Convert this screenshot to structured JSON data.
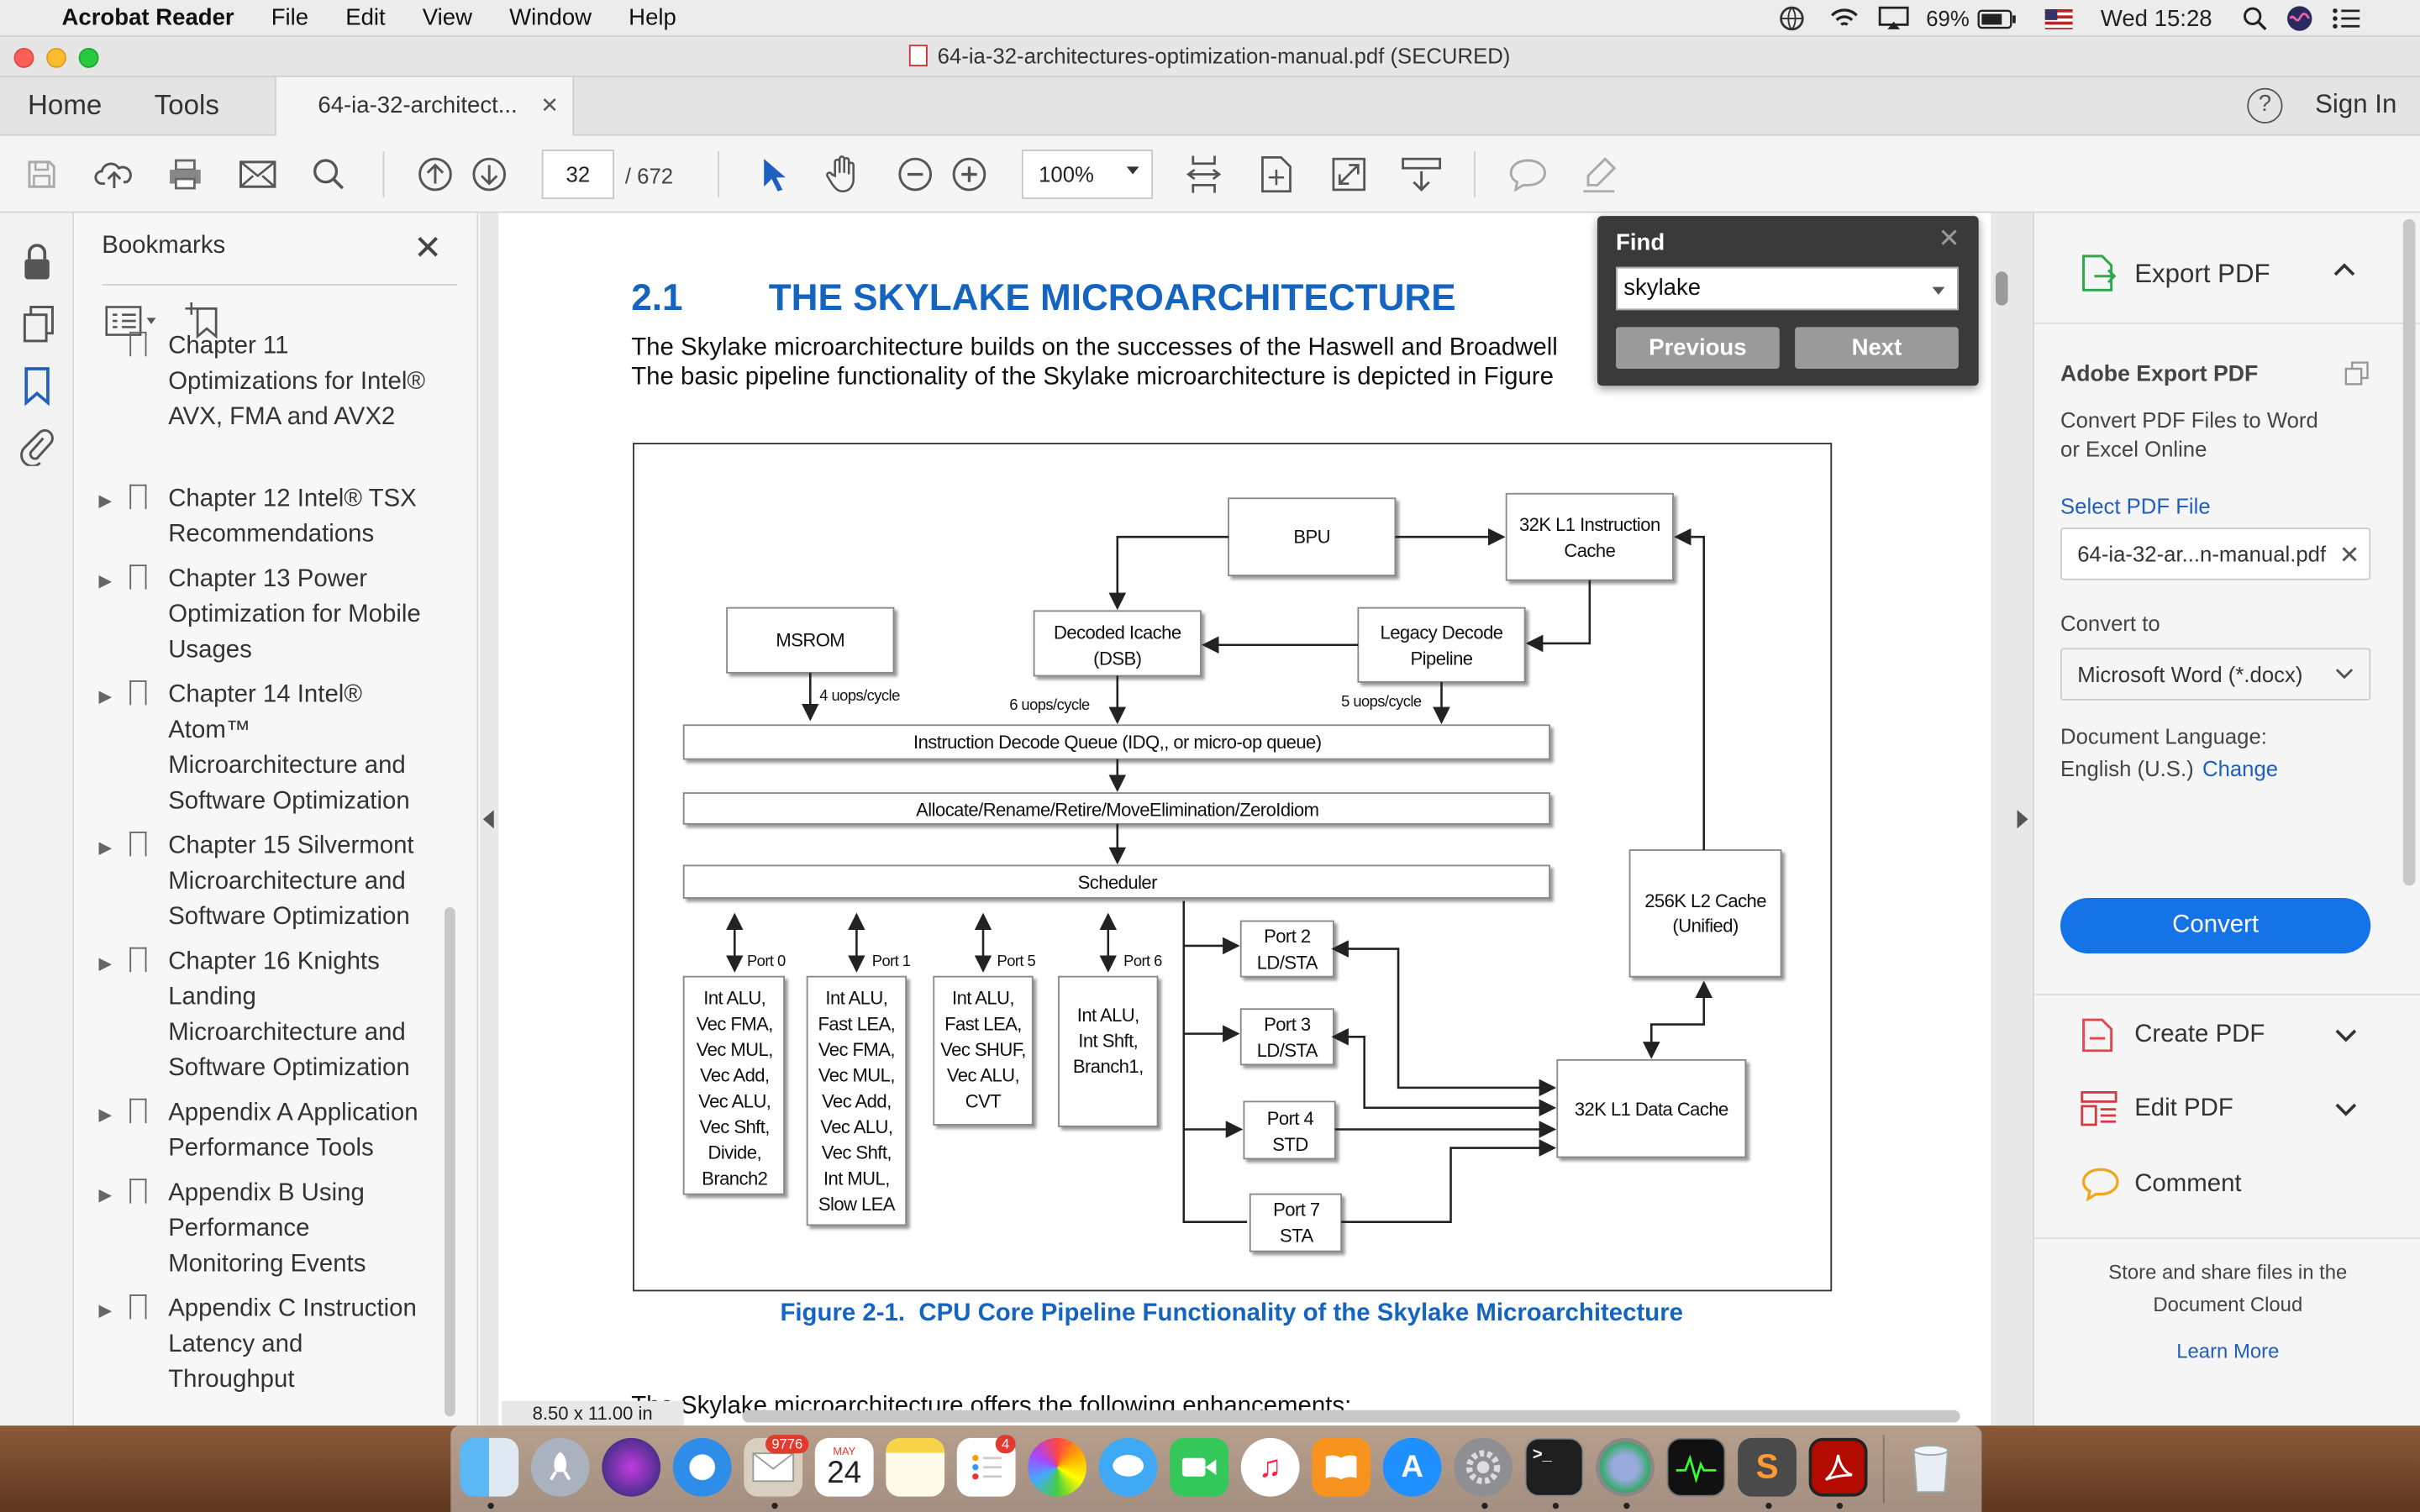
{
  "menubar": {
    "app": "Acrobat Reader",
    "items": [
      "File",
      "Edit",
      "View",
      "Window",
      "Help"
    ],
    "battery": "69%",
    "clock": "Wed 15:28"
  },
  "window": {
    "title": "64-ia-32-architectures-optimization-manual.pdf (SECURED)"
  },
  "tabs": {
    "home": "Home",
    "tools": "Tools",
    "document": "64-ia-32-architect...",
    "help": "?",
    "signin": "Sign In"
  },
  "toolbar": {
    "page_current": "32",
    "page_total": "/ 672",
    "zoom": "100%"
  },
  "bookmarks": {
    "title": "Bookmarks",
    "items": [
      {
        "lines": [
          "Chapter 11",
          "Optimizations for Intel®",
          "AVX, FMA and AVX2"
        ]
      },
      {
        "lines": [
          "Chapter 12 Intel® TSX",
          "Recommendations"
        ]
      },
      {
        "lines": [
          "Chapter 13 Power",
          "Optimization for Mobile",
          "Usages"
        ]
      },
      {
        "lines": [
          "Chapter 14 Intel®",
          "Atom™",
          "Microarchitecture and",
          "Software Optimization"
        ]
      },
      {
        "lines": [
          "Chapter 15 Silvermont",
          "Microarchitecture and",
          "Software Optimization"
        ]
      },
      {
        "lines": [
          "Chapter 16 Knights",
          "Landing",
          "Microarchitecture and",
          "Software Optimization"
        ]
      },
      {
        "lines": [
          "Appendix A Application",
          "Performance Tools"
        ]
      },
      {
        "lines": [
          "Appendix B Using",
          "Performance",
          "Monitoring Events"
        ]
      },
      {
        "lines": [
          "Appendix C Instruction",
          "Latency and",
          "Throughput"
        ]
      }
    ]
  },
  "document": {
    "section_num": "2.1",
    "section_title": "THE SKYLAKE MICROARCHITECTURE",
    "para_line1": "The Skylake microarchitecture builds on the successes of the Haswell and Broadwell",
    "para_line2": "The basic pipeline functionality of the Skylake microarchitecture is depicted in Figure",
    "caption": "Figure 2-1.  CPU Core Pipeline Functionality of the Skylake Microarchitecture",
    "next_line": "The Skylake microarchitecture offers the following enhancements:",
    "page_size": "8.50 x 11.00 in",
    "diagram": {
      "bpu": "BPU",
      "l1i_1": "32K L1 Instruction",
      "l1i_2": "Cache",
      "msrom": "MSROM",
      "dsb_1": "Decoded Icache",
      "dsb_2": "(DSB)",
      "legacy_1": "Legacy Decode",
      "legacy_2": "Pipeline",
      "rate_msrom": "4 uops/cycle",
      "rate_dsb": "6 uops/cycle",
      "rate_legacy": "5 uops/cycle",
      "idq": "Instruction Decode Queue (IDQ,, or micro-op queue)",
      "alloc": "Allocate/Rename/Retire/MoveElimination/ZeroIdiom",
      "sched": "Scheduler",
      "l2_1": "256K L2 Cache",
      "l2_2": "(Unified)",
      "port0": "Port 0",
      "port1": "Port 1",
      "port5": "Port 5",
      "port6": "Port 6",
      "p0": [
        "Int ALU,",
        "Vec FMA,",
        "Vec MUL,",
        "Vec Add,",
        "Vec ALU,",
        "Vec Shft,",
        "Divide,",
        "Branch2"
      ],
      "p1": [
        "Int ALU,",
        "Fast LEA,",
        "Vec FMA,",
        "Vec MUL,",
        "Vec Add,",
        "Vec ALU,",
        "Vec Shft,",
        "Int MUL,",
        "Slow LEA"
      ],
      "p5": [
        "Int ALU,",
        "Fast LEA,",
        "Vec SHUF,",
        "Vec ALU,",
        "CVT"
      ],
      "p6": [
        "Int ALU,",
        "Int Shft,",
        "Branch1,"
      ],
      "port2": [
        "Port 2",
        "LD/STA"
      ],
      "port3": [
        "Port 3",
        "LD/STA"
      ],
      "port4": [
        "Port 4",
        "STD"
      ],
      "port7": [
        "Port 7",
        "STA"
      ],
      "l1d": "32K L1 Data Cache"
    }
  },
  "find": {
    "title": "Find",
    "query": "skylake",
    "previous": "Previous",
    "next": "Next"
  },
  "right_panel": {
    "export_pdf": "Export PDF",
    "adobe_export": "Adobe Export PDF",
    "desc_1": "Convert PDF Files to Word",
    "desc_2": "or Excel Online",
    "select_file": "Select PDF File",
    "file_name": "64-ia-32-ar...n-manual.pdf",
    "convert_to": "Convert to",
    "format": "Microsoft Word (*.docx)",
    "doc_lang": "Document Language:",
    "lang": "English (U.S.)",
    "change": "Change",
    "convert_btn": "Convert",
    "create_pdf": "Create PDF",
    "edit_pdf": "Edit PDF",
    "comment": "Comment",
    "store_1": "Store and share files in the",
    "store_2": "Document Cloud",
    "learn_more": "Learn More"
  },
  "dock": {
    "mail_badge": "9776",
    "calendar_month": "MAY",
    "calendar_day": "24",
    "reminders_badge": "4"
  }
}
